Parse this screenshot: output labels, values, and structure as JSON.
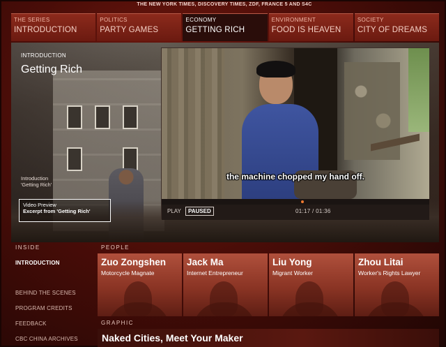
{
  "sponsor": "THE NEW YORK TIMES, DISCOVERY TIMES, ZDF, FRANCE 5 AND S4C",
  "nav": [
    {
      "category": "THE SERIES",
      "title": "INTRODUCTION",
      "active": false
    },
    {
      "category": "POLITICS",
      "title": "PARTY GAMES",
      "active": false
    },
    {
      "category": "ECONOMY",
      "title": "GETTING RICH",
      "active": true
    },
    {
      "category": "ENVIRONMENT",
      "title": "FOOD IS HEAVEN",
      "active": false
    },
    {
      "category": "SOCIETY",
      "title": "CITY OF DREAMS",
      "active": false
    }
  ],
  "hero": {
    "kicker": "INTRODUCTION",
    "title": "Getting Rich",
    "intro_link_line1": "Introduction",
    "intro_link_line2": "'Getting Rich'",
    "preview_line1": "Video Preview",
    "preview_line2": "Excerpt from 'Getting Rich'"
  },
  "video": {
    "subtitle": "the machine chopped my hand off.",
    "play_label": "PLAY",
    "paused_label": "PAUSED",
    "time": "01:17  /  01:36",
    "progress": 0.8
  },
  "inside": {
    "label": "INSIDE",
    "items": [
      {
        "label": "INTRODUCTION",
        "active": true
      },
      {
        "label": "BEHIND THE SCENES",
        "active": false
      },
      {
        "label": "PROGRAM CREDITS",
        "active": false
      },
      {
        "label": "FEEDBACK",
        "active": false
      },
      {
        "label": "CBC CHINA ARCHIVES",
        "active": false
      }
    ]
  },
  "people": {
    "label": "PEOPLE",
    "items": [
      {
        "name": "Zuo Zongshen",
        "role": "Motorcycle Magnate"
      },
      {
        "name": "Jack Ma",
        "role": "Internet Entrepreneur"
      },
      {
        "name": "Liu Yong",
        "role": "Migrant Worker"
      },
      {
        "name": "Zhou Litai",
        "role": "Worker's Rights Lawyer"
      }
    ]
  },
  "graphic": {
    "label": "GRAPHIC",
    "title": "Naked Cities, Meet Your Maker"
  }
}
